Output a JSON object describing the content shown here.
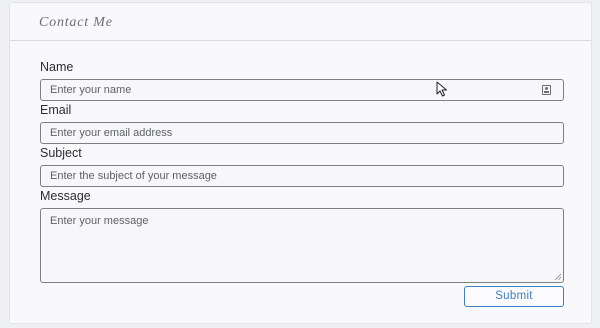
{
  "form": {
    "title": "Contact Me",
    "fields": [
      {
        "label": "Name",
        "placeholder": "Enter your name",
        "value": ""
      },
      {
        "label": "Email",
        "placeholder": "Enter your email address",
        "value": ""
      },
      {
        "label": "Subject",
        "placeholder": "Enter the subject of your message",
        "value": ""
      },
      {
        "label": "Message",
        "placeholder": "Enter your message",
        "value": ""
      }
    ],
    "submit_label": "Submit"
  },
  "icons": {
    "name_field_icon": "contact-card-icon",
    "textarea_handle": "resize-handle-icon",
    "pointer": "mouse-cursor-icon"
  },
  "colors": {
    "accent": "#3f7fbf",
    "border": "#7b8089",
    "background": "#f9f9fb"
  }
}
